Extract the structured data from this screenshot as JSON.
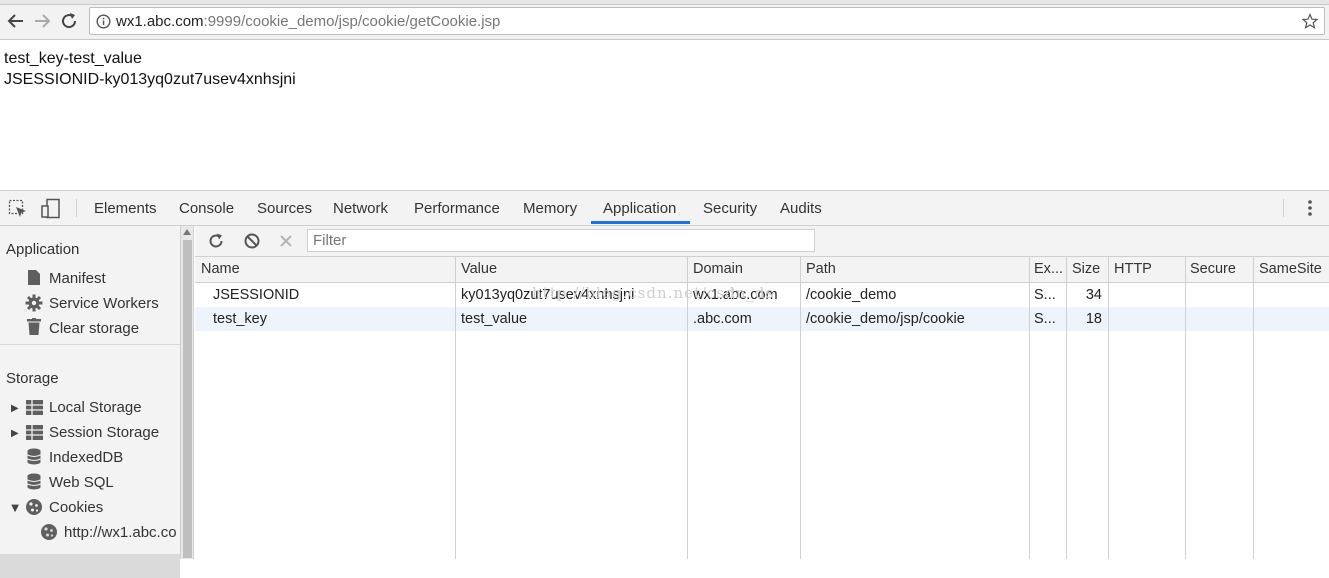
{
  "browser": {
    "url_host": "wx1.abc.com",
    "url_rest": ":9999/cookie_demo/jsp/cookie/getCookie.jsp"
  },
  "page": {
    "lines": [
      "test_key-test_value",
      "JSESSIONID-ky013yq0zut7usev4xnhsjni"
    ]
  },
  "devtools": {
    "tabs": [
      "Elements",
      "Console",
      "Sources",
      "Network",
      "Performance",
      "Memory",
      "Application",
      "Security",
      "Audits"
    ],
    "active_tab": "Application",
    "sidebar": {
      "application_header": "Application",
      "application_items": [
        "Manifest",
        "Service Workers",
        "Clear storage"
      ],
      "storage_header": "Storage",
      "storage_items": [
        "Local Storage",
        "Session Storage",
        "IndexedDB",
        "Web SQL",
        "Cookies"
      ],
      "cookie_origin": "http://wx1.abc.co"
    },
    "filter_placeholder": "Filter",
    "columns": [
      "Name",
      "Value",
      "Domain",
      "Path",
      "Ex...",
      "Size",
      "HTTP",
      "Secure",
      "SameSite"
    ],
    "rows": [
      {
        "name": "JSESSIONID",
        "value": "ky013yq0zut7usev4xnhsjni",
        "domain": "wx1.abc.com",
        "path": "/cookie_demo",
        "expires": "S...",
        "size": "34",
        "http": "",
        "secure": "",
        "samesite": ""
      },
      {
        "name": "test_key",
        "value": "test_value",
        "domain": ".abc.com",
        "path": "/cookie_demo/jsp/cookie",
        "expires": "S...",
        "size": "18",
        "http": "",
        "secure": "",
        "samesite": ""
      }
    ],
    "watermark": "http://blog.csdn.net/csdn_ds"
  }
}
